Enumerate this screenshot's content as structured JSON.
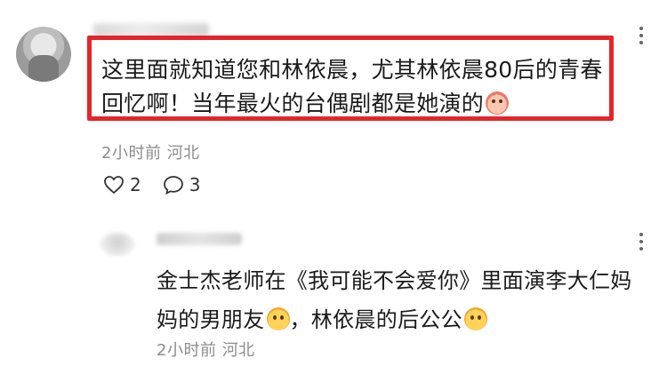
{
  "comment": {
    "text": "这里面就知道您和林依晨，尤其林依晨80后的青春回忆啊！当年最火的台偶剧都是她演的",
    "time": "2小时前",
    "location": "河北",
    "likes": "2",
    "replies": "3",
    "highlight_color": "#e3262c"
  },
  "reply": {
    "text_part1": "金士杰老师在《我可能不会爱你》里面演李大仁妈妈的男朋友",
    "text_part2": "，林依晨的后公公",
    "time": "2小时前",
    "location": "河北"
  },
  "icons": {
    "like": "heart-outline-icon",
    "reply": "speech-bubble-icon",
    "more": "more-vertical-icon"
  }
}
